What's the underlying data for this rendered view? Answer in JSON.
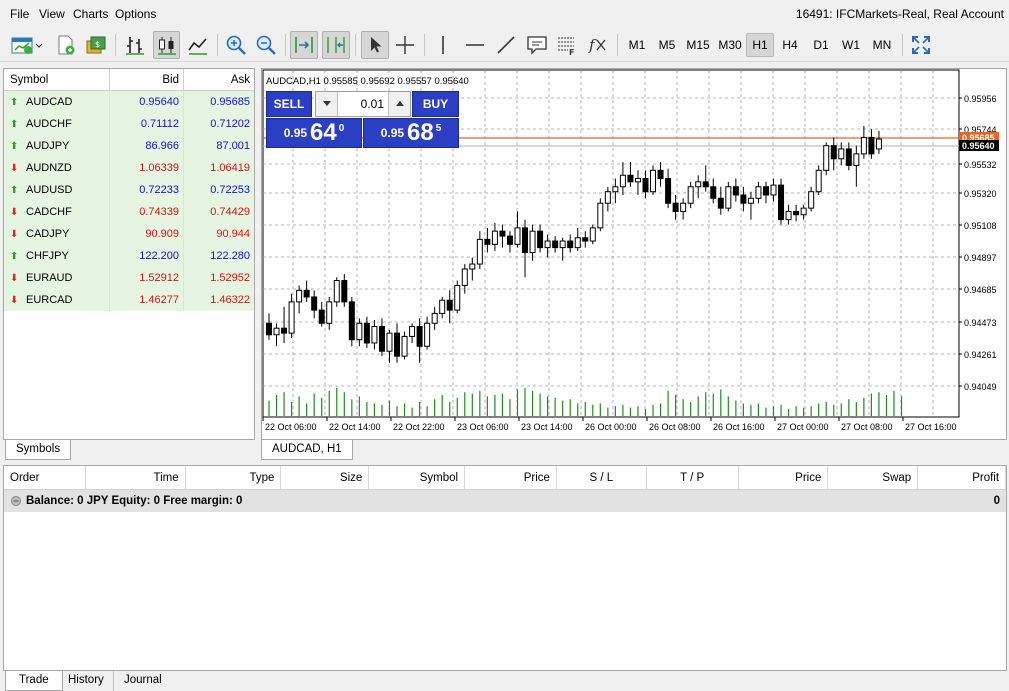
{
  "menu": [
    "File",
    "View",
    "Charts",
    "Options"
  ],
  "account": "16491: IFCMarkets-Real, Real Account",
  "timeframes": [
    "M1",
    "M5",
    "M15",
    "M30",
    "H1",
    "H4",
    "D1",
    "W1",
    "MN"
  ],
  "active_timeframe": "H1",
  "market_watch": {
    "headers": {
      "symbol": "Symbol",
      "bid": "Bid",
      "ask": "Ask"
    },
    "rows": [
      {
        "symbol": "AUDCAD",
        "dir": "up",
        "bid": "0.95640",
        "ask": "0.95685",
        "color": "blue"
      },
      {
        "symbol": "AUDCHF",
        "dir": "up",
        "bid": "0.71112",
        "ask": "0.71202",
        "color": "blue"
      },
      {
        "symbol": "AUDJPY",
        "dir": "up",
        "bid": "86.966",
        "ask": "87.001",
        "color": "blue"
      },
      {
        "symbol": "AUDNZD",
        "dir": "down",
        "bid": "1.06339",
        "ask": "1.06419",
        "color": "red"
      },
      {
        "symbol": "AUDUSD",
        "dir": "up",
        "bid": "0.72233",
        "ask": "0.72253",
        "color": "blue"
      },
      {
        "symbol": "CADCHF",
        "dir": "down",
        "bid": "0.74339",
        "ask": "0.74429",
        "color": "red"
      },
      {
        "symbol": "CADJPY",
        "dir": "down",
        "bid": "90.909",
        "ask": "90.944",
        "color": "red"
      },
      {
        "symbol": "CHFJPY",
        "dir": "up",
        "bid": "122.200",
        "ask": "122.280",
        "color": "blue"
      },
      {
        "symbol": "EURAUD",
        "dir": "down",
        "bid": "1.52912",
        "ask": "1.52952",
        "color": "red"
      },
      {
        "symbol": "EURCAD",
        "dir": "down",
        "bid": "1.46277",
        "ask": "1.46322",
        "color": "red"
      }
    ],
    "tab": "Symbols"
  },
  "chart": {
    "header": "AUDCAD,H1  0.95585 0.95692 0.95557 0.95640",
    "tab": "AUDCAD, H1",
    "one_click": {
      "sell": "SELL",
      "buy": "BUY",
      "lot": "0.01",
      "sell_prefix": "0.95",
      "sell_big": "64",
      "sell_sup": "0",
      "buy_prefix": "0.95",
      "buy_big": "68",
      "buy_sup": "5"
    },
    "price_labels": [
      "0.95956",
      "0.95744",
      "0.95532",
      "0.95320",
      "0.95108",
      "0.94897",
      "0.94685",
      "0.94473",
      "0.94261",
      "0.94049"
    ],
    "ask_label": "0.95685",
    "bid_label": "0.95640",
    "time_labels": [
      "22 Oct 06:00",
      "22 Oct 14:00",
      "22 Oct 22:00",
      "23 Oct 06:00",
      "23 Oct 14:00",
      "26 Oct 00:00",
      "26 Oct 08:00",
      "26 Oct 16:00",
      "27 Oct 00:00",
      "27 Oct 08:00",
      "27 Oct 16:00"
    ],
    "colors": {
      "ask_line": "#e8651e",
      "bid_line": "#b0b0b0",
      "volume": "#1e8c1e",
      "grid": "#9aa0a6"
    }
  },
  "chart_data": {
    "type": "candlestick",
    "symbol": "AUDCAD",
    "timeframe": "H1",
    "ylim": [
      0.9395,
      0.9606
    ],
    "candles": [
      [
        0.9452,
        0.9458,
        0.9442,
        0.9445
      ],
      [
        0.9445,
        0.9452,
        0.9438,
        0.9449
      ],
      [
        0.9449,
        0.9462,
        0.944,
        0.9446
      ],
      [
        0.9446,
        0.947,
        0.9443,
        0.9465
      ],
      [
        0.9465,
        0.9475,
        0.9458,
        0.9472
      ],
      [
        0.9472,
        0.9478,
        0.9465,
        0.9468
      ],
      [
        0.9468,
        0.9472,
        0.9455,
        0.946
      ],
      [
        0.946,
        0.9465,
        0.945,
        0.9452
      ],
      [
        0.9452,
        0.9468,
        0.9448,
        0.9465
      ],
      [
        0.9465,
        0.948,
        0.9462,
        0.9478
      ],
      [
        0.9478,
        0.9482,
        0.9462,
        0.9465
      ],
      [
        0.9465,
        0.9468,
        0.9438,
        0.9442
      ],
      [
        0.9442,
        0.9455,
        0.9438,
        0.9452
      ],
      [
        0.9452,
        0.9456,
        0.9437,
        0.944
      ],
      [
        0.944,
        0.9454,
        0.9436,
        0.945
      ],
      [
        0.945,
        0.9455,
        0.9432,
        0.9435
      ],
      [
        0.9435,
        0.9448,
        0.9428,
        0.9446
      ],
      [
        0.9446,
        0.9452,
        0.9428,
        0.9432
      ],
      [
        0.9432,
        0.9447,
        0.943,
        0.9444
      ],
      [
        0.9444,
        0.9452,
        0.944,
        0.945
      ],
      [
        0.945,
        0.9455,
        0.9428,
        0.9438
      ],
      [
        0.9438,
        0.9456,
        0.9436,
        0.9452
      ],
      [
        0.9452,
        0.9462,
        0.9448,
        0.9458
      ],
      [
        0.9458,
        0.9468,
        0.9455,
        0.9466
      ],
      [
        0.9466,
        0.9472,
        0.9452,
        0.946
      ],
      [
        0.946,
        0.9478,
        0.9458,
        0.9475
      ],
      [
        0.9475,
        0.9488,
        0.947,
        0.9485
      ],
      [
        0.9485,
        0.9492,
        0.9478,
        0.9488
      ],
      [
        0.9488,
        0.9508,
        0.9485,
        0.9503
      ],
      [
        0.9503,
        0.951,
        0.9495,
        0.95
      ],
      [
        0.95,
        0.9513,
        0.9496,
        0.9508
      ],
      [
        0.9508,
        0.9512,
        0.9498,
        0.9505
      ],
      [
        0.9505,
        0.9508,
        0.9495,
        0.95
      ],
      [
        0.95,
        0.952,
        0.9498,
        0.951
      ],
      [
        0.951,
        0.9515,
        0.948,
        0.9495
      ],
      [
        0.9495,
        0.9512,
        0.949,
        0.9508
      ],
      [
        0.9508,
        0.9512,
        0.9495,
        0.9498
      ],
      [
        0.9498,
        0.9506,
        0.9492,
        0.9502
      ],
      [
        0.9502,
        0.9505,
        0.9495,
        0.9498
      ],
      [
        0.9498,
        0.9504,
        0.949,
        0.9502
      ],
      [
        0.9502,
        0.9506,
        0.9495,
        0.9498
      ],
      [
        0.9498,
        0.951,
        0.9496,
        0.9504
      ],
      [
        0.9504,
        0.9508,
        0.9498,
        0.9502
      ],
      [
        0.9502,
        0.9512,
        0.95,
        0.951
      ],
      [
        0.951,
        0.9528,
        0.9508,
        0.9525
      ],
      [
        0.9525,
        0.9535,
        0.952,
        0.9532
      ],
      [
        0.9532,
        0.954,
        0.9525,
        0.9535
      ],
      [
        0.9535,
        0.955,
        0.953,
        0.9542
      ],
      [
        0.9542,
        0.955,
        0.9535,
        0.9538
      ],
      [
        0.9538,
        0.9545,
        0.953,
        0.954
      ],
      [
        0.954,
        0.9545,
        0.9528,
        0.9532
      ],
      [
        0.9532,
        0.9548,
        0.953,
        0.9545
      ],
      [
        0.9545,
        0.955,
        0.9535,
        0.954
      ],
      [
        0.954,
        0.9546,
        0.9522,
        0.9525
      ],
      [
        0.9525,
        0.953,
        0.9515,
        0.952
      ],
      [
        0.952,
        0.9528,
        0.9515,
        0.9525
      ],
      [
        0.9525,
        0.9538,
        0.9522,
        0.9535
      ],
      [
        0.9535,
        0.9542,
        0.9528,
        0.9538
      ],
      [
        0.9538,
        0.9548,
        0.9532,
        0.9535
      ],
      [
        0.9535,
        0.954,
        0.9525,
        0.9528
      ],
      [
        0.9528,
        0.9535,
        0.9518,
        0.9522
      ],
      [
        0.9522,
        0.9538,
        0.952,
        0.9535
      ],
      [
        0.9535,
        0.954,
        0.9526,
        0.953
      ],
      [
        0.953,
        0.9535,
        0.952,
        0.9525
      ],
      [
        0.9525,
        0.9532,
        0.9515,
        0.9528
      ],
      [
        0.9528,
        0.9538,
        0.9525,
        0.9535
      ],
      [
        0.9535,
        0.9538,
        0.9525,
        0.953
      ],
      [
        0.953,
        0.954,
        0.9526,
        0.9536
      ],
      [
        0.9536,
        0.954,
        0.9512,
        0.9515
      ],
      [
        0.9515,
        0.9524,
        0.9512,
        0.952
      ],
      [
        0.952,
        0.9524,
        0.9514,
        0.9518
      ],
      [
        0.9518,
        0.9524,
        0.9515,
        0.9522
      ],
      [
        0.9522,
        0.9535,
        0.952,
        0.9532
      ],
      [
        0.9532,
        0.9548,
        0.953,
        0.9545
      ],
      [
        0.9545,
        0.9562,
        0.9542,
        0.956
      ],
      [
        0.956,
        0.9565,
        0.9545,
        0.9552
      ],
      [
        0.9552,
        0.9562,
        0.9548,
        0.9558
      ],
      [
        0.9558,
        0.9562,
        0.9545,
        0.9548
      ],
      [
        0.9548,
        0.956,
        0.9535,
        0.9555
      ],
      [
        0.9555,
        0.9572,
        0.9552,
        0.9565
      ],
      [
        0.9565,
        0.957,
        0.9552,
        0.9555
      ],
      [
        0.9558,
        0.9569,
        0.9555,
        0.9564
      ]
    ],
    "volume_relative": [
      0.55,
      0.75,
      0.85,
      0.5,
      0.7,
      0.45,
      0.8,
      0.65,
      0.9,
      1.0,
      0.85,
      0.6,
      0.7,
      0.5,
      0.45,
      0.4,
      0.55,
      0.35,
      0.45,
      0.3,
      0.5,
      0.35,
      0.6,
      0.75,
      0.5,
      0.65,
      0.85,
      0.8,
      0.9,
      0.7,
      0.75,
      0.8,
      0.6,
      0.95,
      1.0,
      0.9,
      0.8,
      0.7,
      0.65,
      0.55,
      0.6,
      0.45,
      0.5,
      0.4,
      0.45,
      0.3,
      0.35,
      0.4,
      0.3,
      0.35,
      0.25,
      0.4,
      0.45,
      0.9,
      0.75,
      0.6,
      0.5,
      0.7,
      0.85,
      0.8,
      0.95,
      0.7,
      0.55,
      0.45,
      0.4,
      0.45,
      0.3,
      0.35,
      0.4,
      0.25,
      0.35,
      0.3,
      0.35,
      0.45,
      0.5,
      0.4,
      0.45,
      0.6,
      0.5,
      0.65,
      0.8,
      0.85,
      0.75,
      0.9,
      0.7
    ]
  },
  "toolbox": {
    "headers": [
      "Order",
      "Time",
      "Type",
      "Size",
      "Symbol",
      "Price",
      "S / L",
      "T / P",
      "Price",
      "Swap",
      "Profit"
    ],
    "balance_line": "Balance: 0 JPY  Equity: 0  Free margin: 0",
    "balance_profit": "0",
    "tabs": [
      "Trade",
      "History",
      "Journal"
    ]
  }
}
